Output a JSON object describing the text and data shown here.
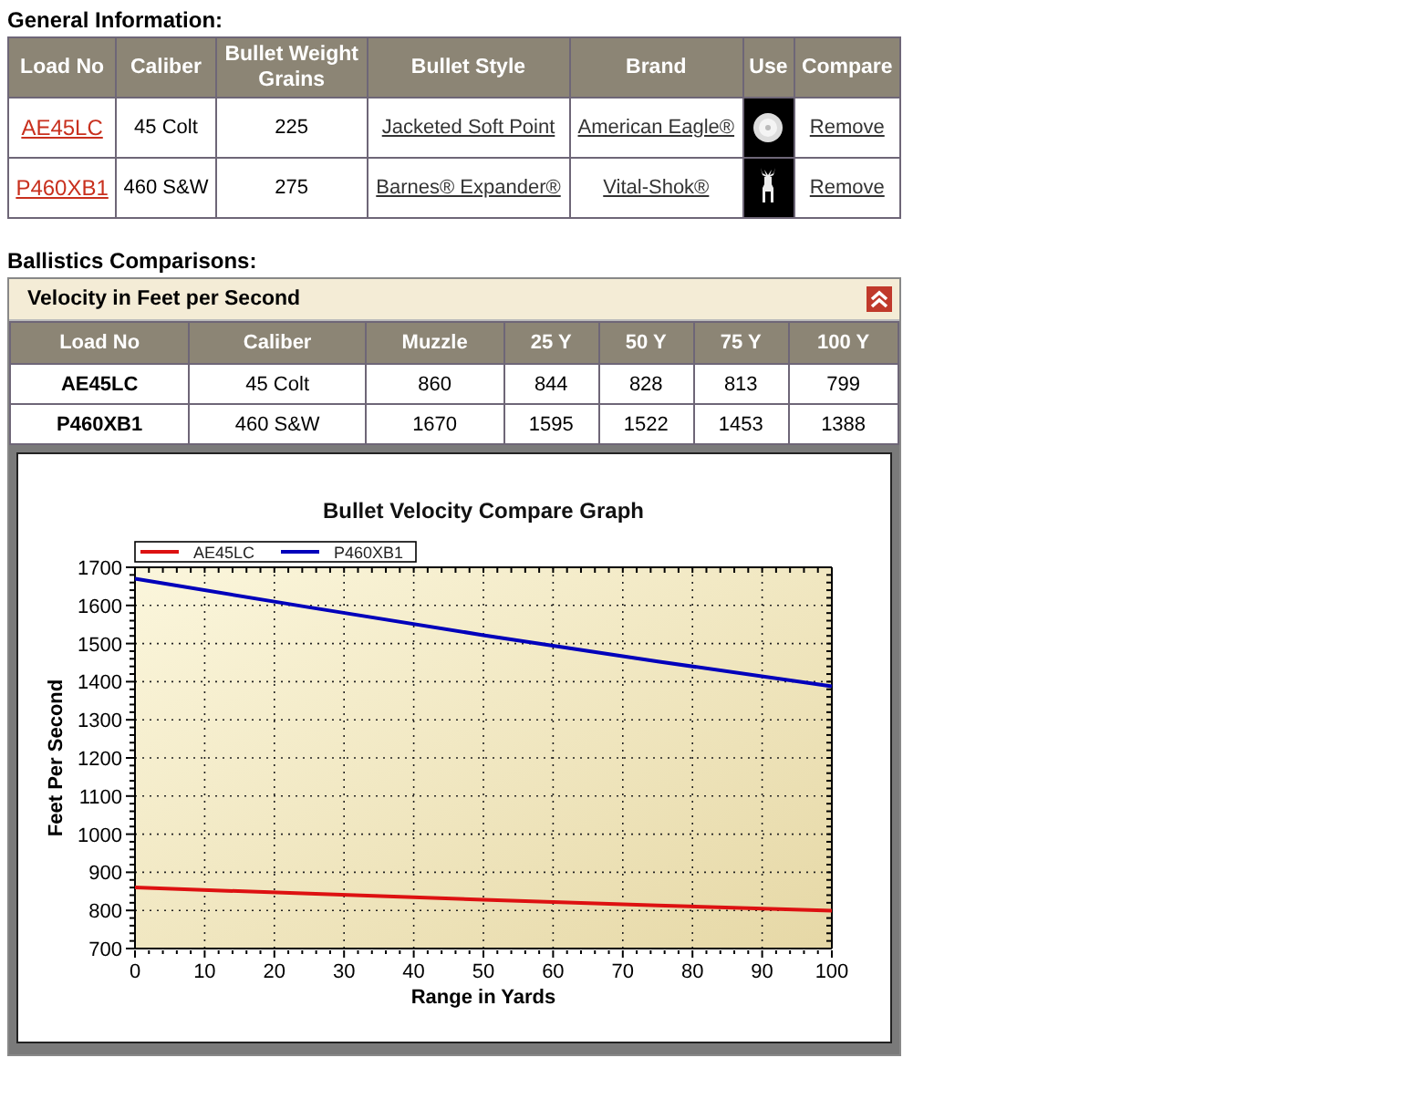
{
  "general": {
    "heading": "General Information:",
    "columns": [
      "Load No",
      "Caliber",
      "Bullet Weight Grains",
      "Bullet Style",
      "Brand",
      "Use",
      "Compare"
    ],
    "rows": [
      {
        "load_no": "AE45LC",
        "caliber": "45 Colt",
        "weight": "225",
        "style": "Jacketed Soft Point",
        "brand": "American Eagle®",
        "kind": "target",
        "compare": "Remove"
      },
      {
        "load_no": "P460XB1",
        "caliber": "460 S&W",
        "weight": "275",
        "style": "Barnes® Expander®",
        "brand": "Vital-Shok®",
        "kind": "deer",
        "compare": "Remove"
      }
    ]
  },
  "ballistics": {
    "heading": "Ballistics Comparisons:",
    "panel": {
      "title": "Velocity in Feet per Second",
      "expanded": true,
      "columns": [
        "Load No",
        "Caliber",
        "Muzzle",
        "25 Y",
        "50 Y",
        "75 Y",
        "100 Y"
      ],
      "rows": [
        [
          "AE45LC",
          "45 Colt",
          "860",
          "844",
          "828",
          "813",
          "799"
        ],
        [
          "P460XB1",
          "460 S&W",
          "1670",
          "1595",
          "1522",
          "1453",
          "1388"
        ]
      ],
      "chart_data": {
        "type": "line",
        "title": "Bullet Velocity Compare Graph",
        "xlabel": "Range in Yards",
        "ylabel": "Feet Per Second",
        "x": [
          0,
          25,
          50,
          75,
          100
        ],
        "series": [
          {
            "name": "AE45LC",
            "color": "#dd1111",
            "values": [
              860,
              844,
              828,
              813,
              799
            ]
          },
          {
            "name": "P460XB1",
            "color": "#0000bb",
            "values": [
              1670,
              1595,
              1522,
              1453,
              1388
            ]
          }
        ],
        "xlim": [
          0,
          100
        ],
        "ylim": [
          700,
          1700
        ],
        "xticks": [
          0,
          10,
          20,
          30,
          40,
          50,
          60,
          70,
          80,
          90,
          100
        ],
        "yticks": [
          700,
          800,
          900,
          1000,
          1100,
          1200,
          1300,
          1400,
          1500,
          1600,
          1700
        ],
        "grid": true,
        "legend": true
      }
    }
  }
}
